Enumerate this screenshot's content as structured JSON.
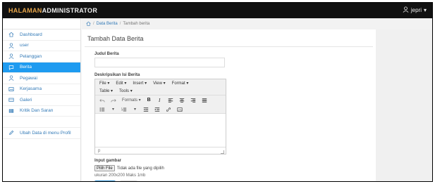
{
  "header": {
    "brand_part1": "HALAMAN",
    "brand_part2": "ADMINISTRATOR",
    "user_name": "jepri",
    "user_icon": "user-icon",
    "caret": "▾"
  },
  "breadcrumb": {
    "home_icon": "home-icon",
    "items": [
      "Data Berita",
      "Tambah berita"
    ],
    "separator": "/"
  },
  "sidebar": {
    "items": [
      {
        "label": "Dashboard",
        "icon": "home-icon"
      },
      {
        "label": "user",
        "icon": "user-icon"
      },
      {
        "label": "Pelanggan",
        "icon": "user-icon"
      },
      {
        "label": "Berita",
        "icon": "comment-icon",
        "active": true
      },
      {
        "label": "Pegawai",
        "icon": "user-icon"
      },
      {
        "label": "Kerjasama",
        "icon": "picture-icon"
      },
      {
        "label": "Galeri",
        "icon": "gallery-icon"
      },
      {
        "label": "Kritik Dan Saran",
        "icon": "table-icon"
      },
      {
        "label": "Ubah Data di menu Profil",
        "icon": "pencil-icon"
      }
    ],
    "active_color": "#1e9bf0",
    "link_color": "#337ab7"
  },
  "form": {
    "title": "Tambah Data Berita",
    "judul_label": "Judul Berita",
    "judul_value": "",
    "deskripsi_label": "Deskripsikan Isi Berita",
    "editor": {
      "menu_row1": [
        "File ▾",
        "Edit ▾",
        "Insert ▾",
        "View ▾",
        "Format ▾"
      ],
      "menu_row2": [
        "Table ▾",
        "Tools ▾"
      ],
      "formats_label": "Formats ▾",
      "bold": "B",
      "italic": "I",
      "status_path": "p"
    },
    "gambar_label": "Input gambar",
    "file_button": "Pilih File",
    "file_status": "Tidak ada file yang dipilih",
    "hint": "ukuran 200x200 Maks 1mb"
  },
  "colors": {
    "topbar": "#111111",
    "brand_accent": "#e8a64a",
    "primary": "#2d8fd4"
  }
}
